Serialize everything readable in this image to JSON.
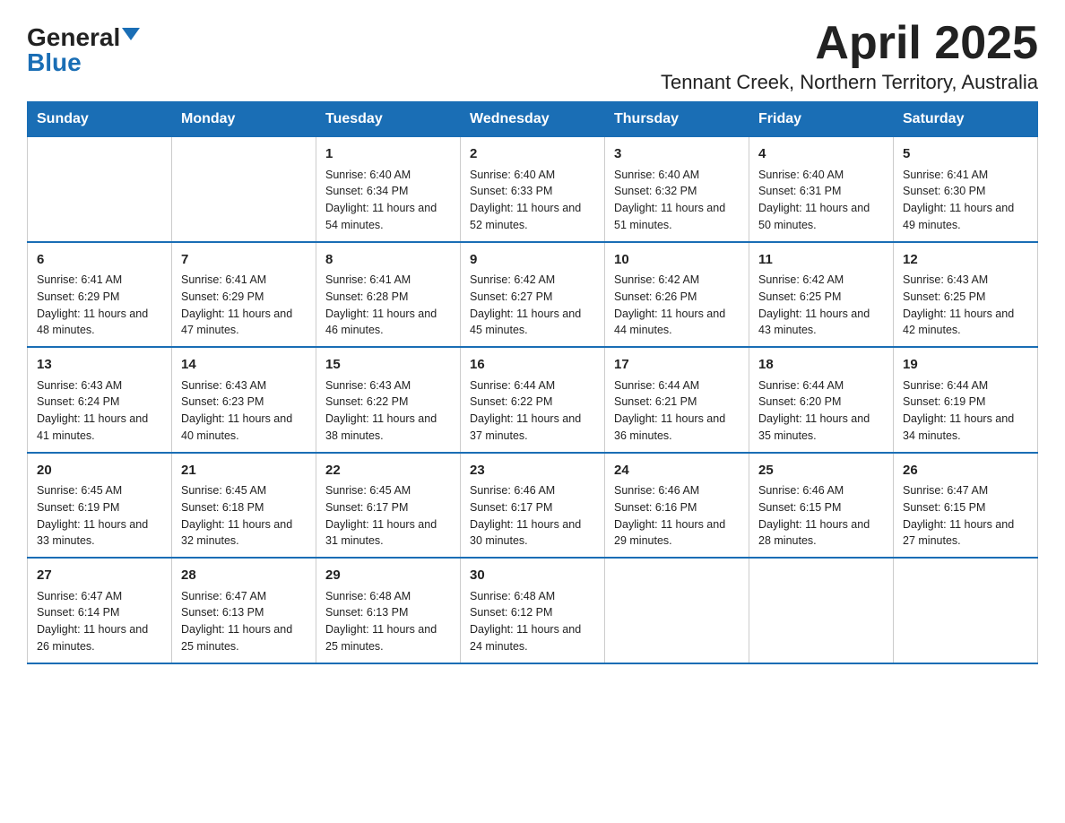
{
  "logo": {
    "general": "General",
    "blue": "Blue"
  },
  "header": {
    "month": "April 2025",
    "location": "Tennant Creek, Northern Territory, Australia"
  },
  "days_of_week": [
    "Sunday",
    "Monday",
    "Tuesday",
    "Wednesday",
    "Thursday",
    "Friday",
    "Saturday"
  ],
  "weeks": [
    [
      {
        "day": "",
        "info": ""
      },
      {
        "day": "",
        "info": ""
      },
      {
        "day": "1",
        "info": "Sunrise: 6:40 AM\nSunset: 6:34 PM\nDaylight: 11 hours and 54 minutes."
      },
      {
        "day": "2",
        "info": "Sunrise: 6:40 AM\nSunset: 6:33 PM\nDaylight: 11 hours and 52 minutes."
      },
      {
        "day": "3",
        "info": "Sunrise: 6:40 AM\nSunset: 6:32 PM\nDaylight: 11 hours and 51 minutes."
      },
      {
        "day": "4",
        "info": "Sunrise: 6:40 AM\nSunset: 6:31 PM\nDaylight: 11 hours and 50 minutes."
      },
      {
        "day": "5",
        "info": "Sunrise: 6:41 AM\nSunset: 6:30 PM\nDaylight: 11 hours and 49 minutes."
      }
    ],
    [
      {
        "day": "6",
        "info": "Sunrise: 6:41 AM\nSunset: 6:29 PM\nDaylight: 11 hours and 48 minutes."
      },
      {
        "day": "7",
        "info": "Sunrise: 6:41 AM\nSunset: 6:29 PM\nDaylight: 11 hours and 47 minutes."
      },
      {
        "day": "8",
        "info": "Sunrise: 6:41 AM\nSunset: 6:28 PM\nDaylight: 11 hours and 46 minutes."
      },
      {
        "day": "9",
        "info": "Sunrise: 6:42 AM\nSunset: 6:27 PM\nDaylight: 11 hours and 45 minutes."
      },
      {
        "day": "10",
        "info": "Sunrise: 6:42 AM\nSunset: 6:26 PM\nDaylight: 11 hours and 44 minutes."
      },
      {
        "day": "11",
        "info": "Sunrise: 6:42 AM\nSunset: 6:25 PM\nDaylight: 11 hours and 43 minutes."
      },
      {
        "day": "12",
        "info": "Sunrise: 6:43 AM\nSunset: 6:25 PM\nDaylight: 11 hours and 42 minutes."
      }
    ],
    [
      {
        "day": "13",
        "info": "Sunrise: 6:43 AM\nSunset: 6:24 PM\nDaylight: 11 hours and 41 minutes."
      },
      {
        "day": "14",
        "info": "Sunrise: 6:43 AM\nSunset: 6:23 PM\nDaylight: 11 hours and 40 minutes."
      },
      {
        "day": "15",
        "info": "Sunrise: 6:43 AM\nSunset: 6:22 PM\nDaylight: 11 hours and 38 minutes."
      },
      {
        "day": "16",
        "info": "Sunrise: 6:44 AM\nSunset: 6:22 PM\nDaylight: 11 hours and 37 minutes."
      },
      {
        "day": "17",
        "info": "Sunrise: 6:44 AM\nSunset: 6:21 PM\nDaylight: 11 hours and 36 minutes."
      },
      {
        "day": "18",
        "info": "Sunrise: 6:44 AM\nSunset: 6:20 PM\nDaylight: 11 hours and 35 minutes."
      },
      {
        "day": "19",
        "info": "Sunrise: 6:44 AM\nSunset: 6:19 PM\nDaylight: 11 hours and 34 minutes."
      }
    ],
    [
      {
        "day": "20",
        "info": "Sunrise: 6:45 AM\nSunset: 6:19 PM\nDaylight: 11 hours and 33 minutes."
      },
      {
        "day": "21",
        "info": "Sunrise: 6:45 AM\nSunset: 6:18 PM\nDaylight: 11 hours and 32 minutes."
      },
      {
        "day": "22",
        "info": "Sunrise: 6:45 AM\nSunset: 6:17 PM\nDaylight: 11 hours and 31 minutes."
      },
      {
        "day": "23",
        "info": "Sunrise: 6:46 AM\nSunset: 6:17 PM\nDaylight: 11 hours and 30 minutes."
      },
      {
        "day": "24",
        "info": "Sunrise: 6:46 AM\nSunset: 6:16 PM\nDaylight: 11 hours and 29 minutes."
      },
      {
        "day": "25",
        "info": "Sunrise: 6:46 AM\nSunset: 6:15 PM\nDaylight: 11 hours and 28 minutes."
      },
      {
        "day": "26",
        "info": "Sunrise: 6:47 AM\nSunset: 6:15 PM\nDaylight: 11 hours and 27 minutes."
      }
    ],
    [
      {
        "day": "27",
        "info": "Sunrise: 6:47 AM\nSunset: 6:14 PM\nDaylight: 11 hours and 26 minutes."
      },
      {
        "day": "28",
        "info": "Sunrise: 6:47 AM\nSunset: 6:13 PM\nDaylight: 11 hours and 25 minutes."
      },
      {
        "day": "29",
        "info": "Sunrise: 6:48 AM\nSunset: 6:13 PM\nDaylight: 11 hours and 25 minutes."
      },
      {
        "day": "30",
        "info": "Sunrise: 6:48 AM\nSunset: 6:12 PM\nDaylight: 11 hours and 24 minutes."
      },
      {
        "day": "",
        "info": ""
      },
      {
        "day": "",
        "info": ""
      },
      {
        "day": "",
        "info": ""
      }
    ]
  ]
}
